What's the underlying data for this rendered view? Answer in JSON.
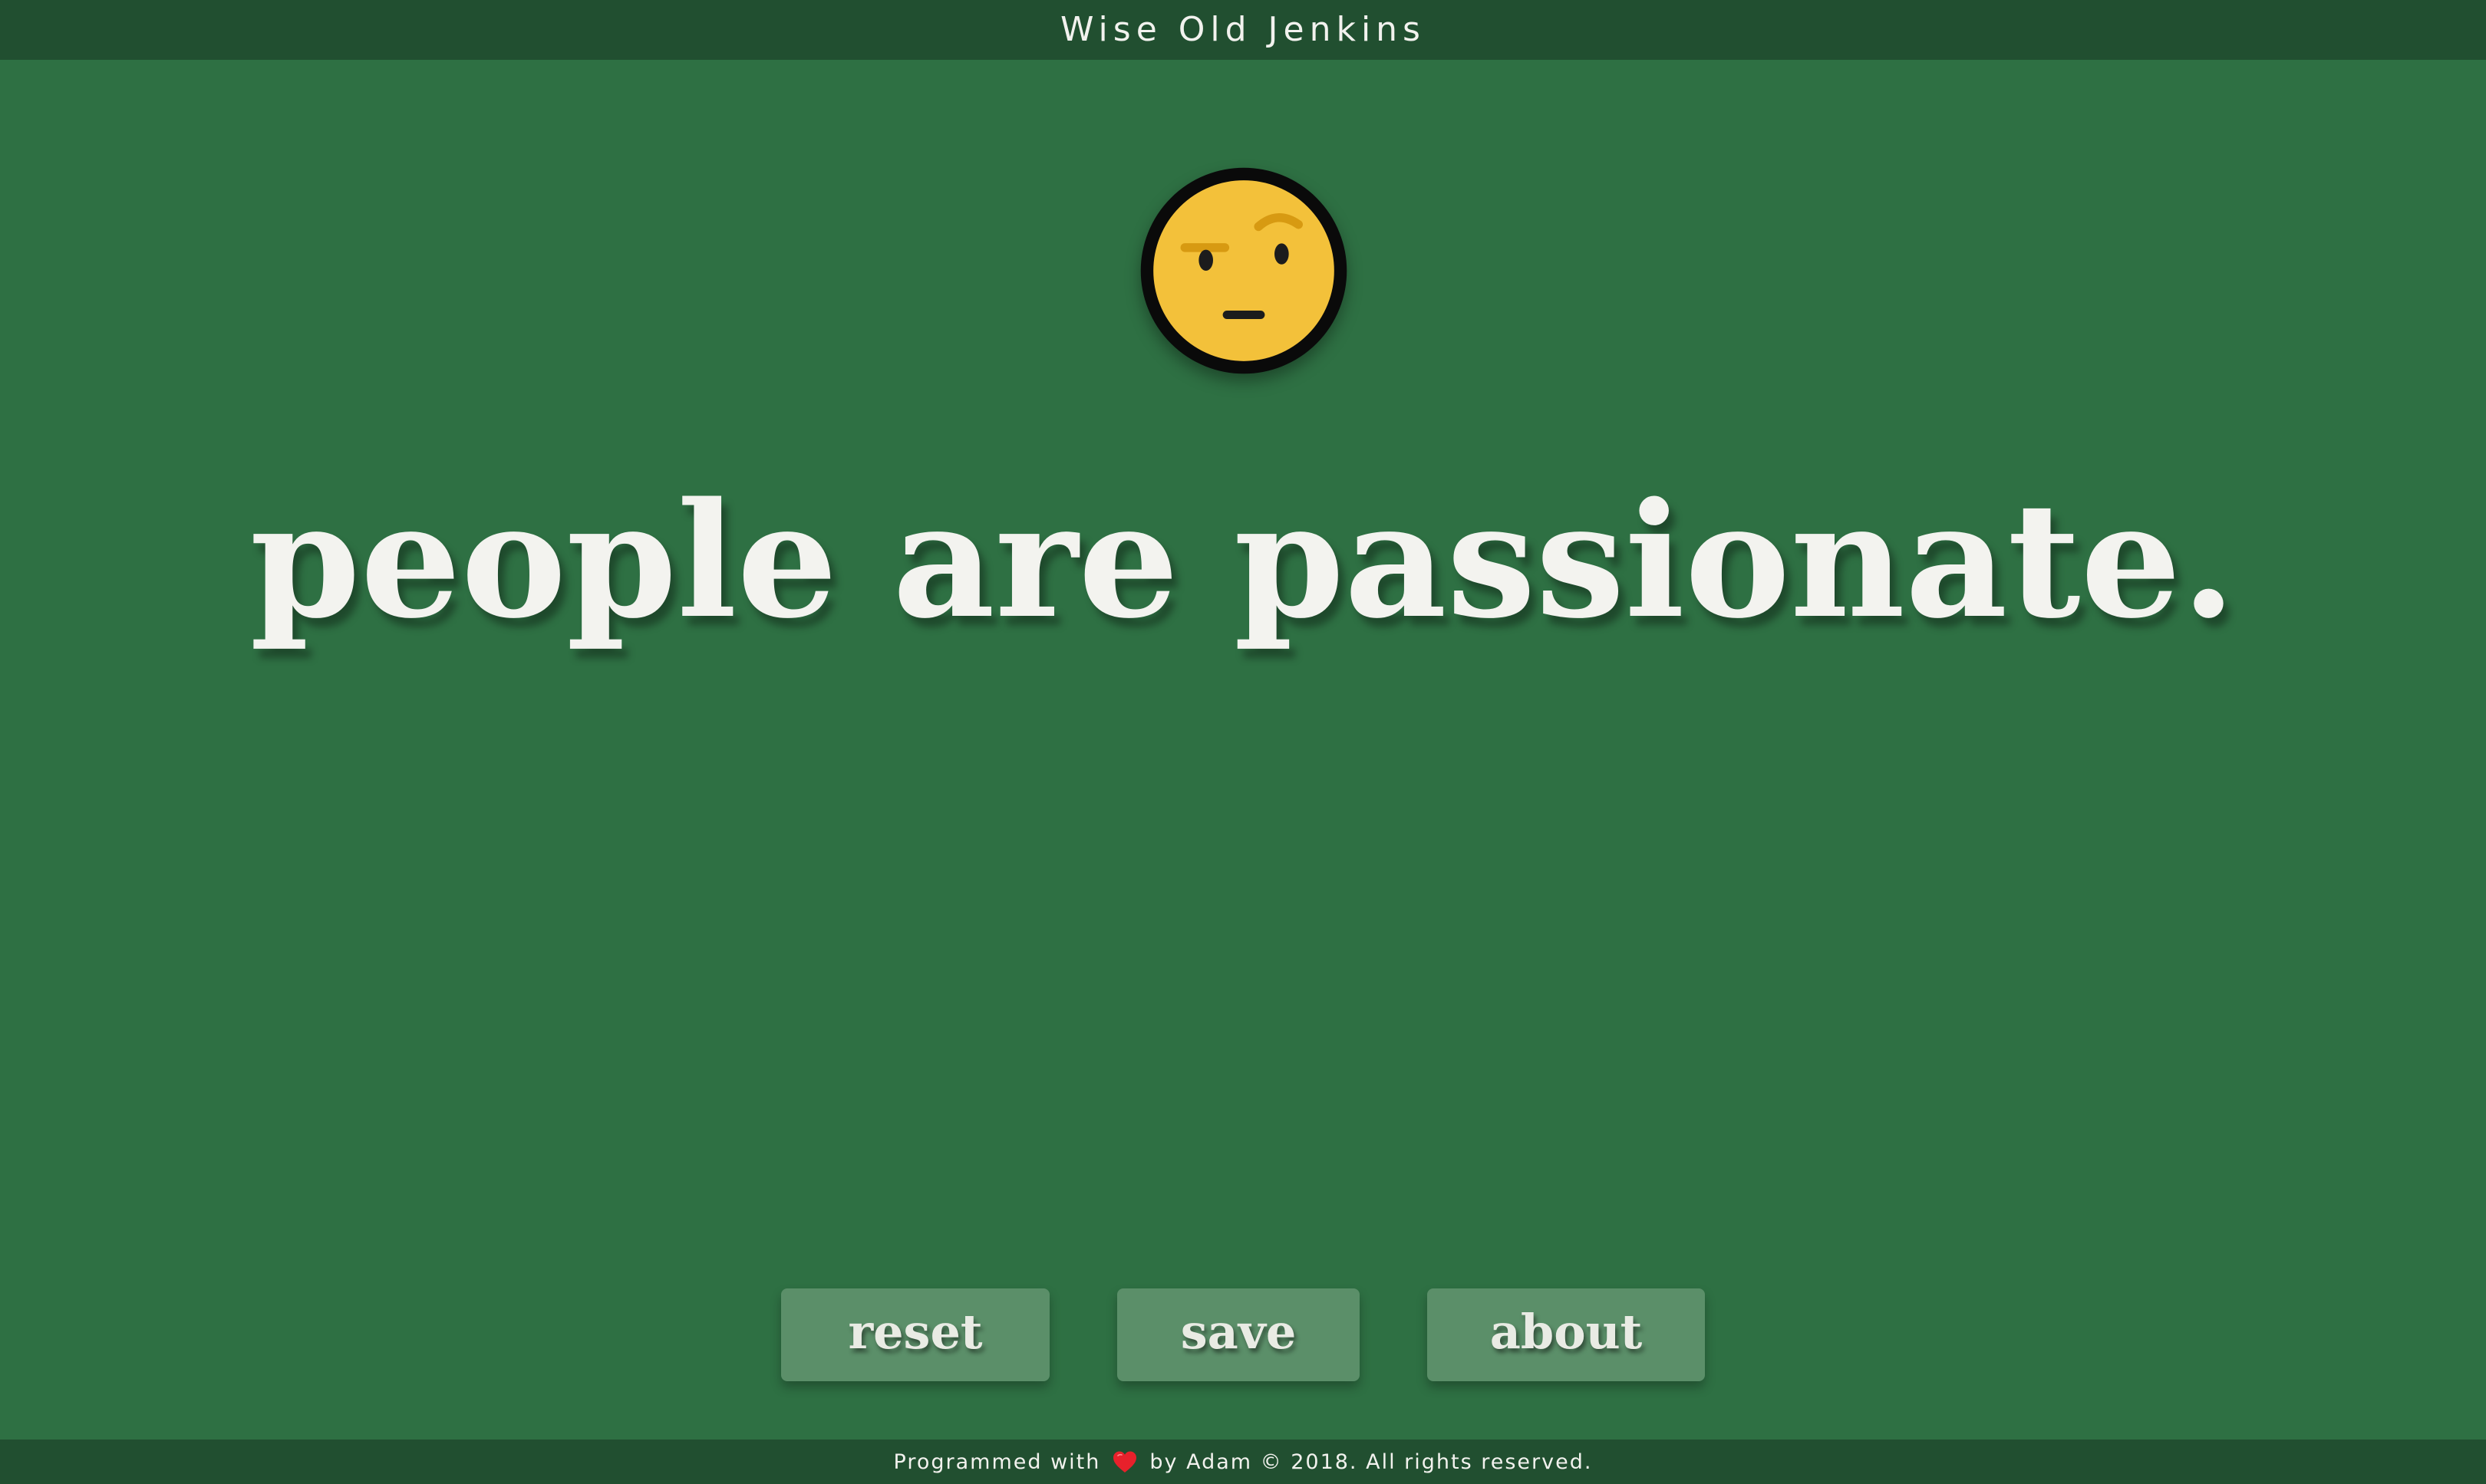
{
  "header": {
    "title": "Wise Old Jenkins"
  },
  "emoji": {
    "icon": "face-with-raised-eyebrow-icon",
    "colors": {
      "face": "#f3c13a",
      "outline": "#0a0a0a",
      "brow": "#d79a12",
      "features": "#1c1c1c"
    }
  },
  "quote": {
    "text": "people are passionate."
  },
  "buttons": {
    "reset_label": "reset",
    "save_label": "save",
    "about_label": "about"
  },
  "footer": {
    "prefix": "Programmed with",
    "heart_icon": "heart-icon",
    "suffix": "by Adam © 2018. All rights reserved."
  },
  "colors": {
    "background": "#2e7043",
    "bars": "#214f30",
    "button": "#5b8f69",
    "text": "#f3f3ef",
    "heart": "#e8212b"
  }
}
